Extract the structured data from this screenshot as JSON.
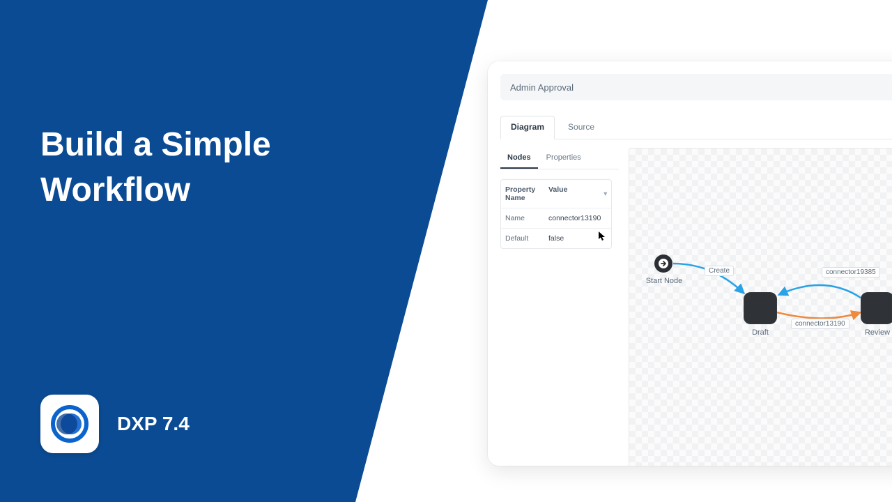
{
  "hero": {
    "title_line1": "Build a Simple",
    "title_line2": "Workflow",
    "product_name": "DXP 7.4"
  },
  "app": {
    "title": "Admin Approval",
    "tabs": {
      "diagram": "Diagram",
      "source": "Source",
      "active": "diagram"
    },
    "subtabs": {
      "nodes": "Nodes",
      "properties": "Properties",
      "active": "nodes"
    },
    "properties": {
      "headers": {
        "key": "Property Name",
        "value": "Value"
      },
      "rows": [
        {
          "key": "Name",
          "value": "connector13190"
        },
        {
          "key": "Default",
          "value": "false"
        }
      ]
    },
    "canvas": {
      "nodes": [
        {
          "id": "start",
          "label": "Start Node"
        },
        {
          "id": "draft",
          "label": "Draft"
        },
        {
          "id": "review",
          "label": "Review"
        }
      ],
      "connectors": [
        {
          "id": "create",
          "label": "Create"
        },
        {
          "id": "c13190",
          "label": "connector13190"
        },
        {
          "id": "c19385",
          "label": "connector19385"
        }
      ]
    }
  },
  "colors": {
    "brand_blue": "#0b4b93",
    "edge_blue": "#2aa2e6",
    "edge_orange": "#f08a3c"
  }
}
